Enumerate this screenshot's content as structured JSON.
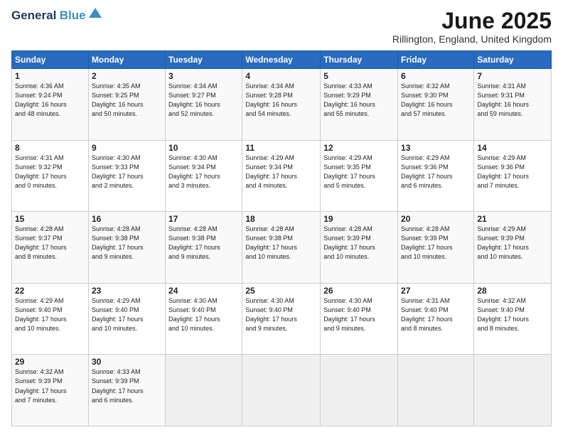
{
  "header": {
    "logo_line1": "General",
    "logo_line2": "Blue",
    "month_title": "June 2025",
    "location": "Rillington, England, United Kingdom"
  },
  "calendar": {
    "days_of_week": [
      "Sunday",
      "Monday",
      "Tuesday",
      "Wednesday",
      "Thursday",
      "Friday",
      "Saturday"
    ],
    "weeks": [
      [
        {
          "day": "1",
          "info": "Sunrise: 4:36 AM\nSunset: 9:24 PM\nDaylight: 16 hours\nand 48 minutes."
        },
        {
          "day": "2",
          "info": "Sunrise: 4:35 AM\nSunset: 9:25 PM\nDaylight: 16 hours\nand 50 minutes."
        },
        {
          "day": "3",
          "info": "Sunrise: 4:34 AM\nSunset: 9:27 PM\nDaylight: 16 hours\nand 52 minutes."
        },
        {
          "day": "4",
          "info": "Sunrise: 4:34 AM\nSunset: 9:28 PM\nDaylight: 16 hours\nand 54 minutes."
        },
        {
          "day": "5",
          "info": "Sunrise: 4:33 AM\nSunset: 9:29 PM\nDaylight: 16 hours\nand 55 minutes."
        },
        {
          "day": "6",
          "info": "Sunrise: 4:32 AM\nSunset: 9:30 PM\nDaylight: 16 hours\nand 57 minutes."
        },
        {
          "day": "7",
          "info": "Sunrise: 4:31 AM\nSunset: 9:31 PM\nDaylight: 16 hours\nand 59 minutes."
        }
      ],
      [
        {
          "day": "8",
          "info": "Sunrise: 4:31 AM\nSunset: 9:32 PM\nDaylight: 17 hours\nand 0 minutes."
        },
        {
          "day": "9",
          "info": "Sunrise: 4:30 AM\nSunset: 9:33 PM\nDaylight: 17 hours\nand 2 minutes."
        },
        {
          "day": "10",
          "info": "Sunrise: 4:30 AM\nSunset: 9:34 PM\nDaylight: 17 hours\nand 3 minutes."
        },
        {
          "day": "11",
          "info": "Sunrise: 4:29 AM\nSunset: 9:34 PM\nDaylight: 17 hours\nand 4 minutes."
        },
        {
          "day": "12",
          "info": "Sunrise: 4:29 AM\nSunset: 9:35 PM\nDaylight: 17 hours\nand 5 minutes."
        },
        {
          "day": "13",
          "info": "Sunrise: 4:29 AM\nSunset: 9:36 PM\nDaylight: 17 hours\nand 6 minutes."
        },
        {
          "day": "14",
          "info": "Sunrise: 4:29 AM\nSunset: 9:36 PM\nDaylight: 17 hours\nand 7 minutes."
        }
      ],
      [
        {
          "day": "15",
          "info": "Sunrise: 4:28 AM\nSunset: 9:37 PM\nDaylight: 17 hours\nand 8 minutes."
        },
        {
          "day": "16",
          "info": "Sunrise: 4:28 AM\nSunset: 9:38 PM\nDaylight: 17 hours\nand 9 minutes."
        },
        {
          "day": "17",
          "info": "Sunrise: 4:28 AM\nSunset: 9:38 PM\nDaylight: 17 hours\nand 9 minutes."
        },
        {
          "day": "18",
          "info": "Sunrise: 4:28 AM\nSunset: 9:38 PM\nDaylight: 17 hours\nand 10 minutes."
        },
        {
          "day": "19",
          "info": "Sunrise: 4:28 AM\nSunset: 9:39 PM\nDaylight: 17 hours\nand 10 minutes."
        },
        {
          "day": "20",
          "info": "Sunrise: 4:28 AM\nSunset: 9:39 PM\nDaylight: 17 hours\nand 10 minutes."
        },
        {
          "day": "21",
          "info": "Sunrise: 4:29 AM\nSunset: 9:39 PM\nDaylight: 17 hours\nand 10 minutes."
        }
      ],
      [
        {
          "day": "22",
          "info": "Sunrise: 4:29 AM\nSunset: 9:40 PM\nDaylight: 17 hours\nand 10 minutes."
        },
        {
          "day": "23",
          "info": "Sunrise: 4:29 AM\nSunset: 9:40 PM\nDaylight: 17 hours\nand 10 minutes."
        },
        {
          "day": "24",
          "info": "Sunrise: 4:30 AM\nSunset: 9:40 PM\nDaylight: 17 hours\nand 10 minutes."
        },
        {
          "day": "25",
          "info": "Sunrise: 4:30 AM\nSunset: 9:40 PM\nDaylight: 17 hours\nand 9 minutes."
        },
        {
          "day": "26",
          "info": "Sunrise: 4:30 AM\nSunset: 9:40 PM\nDaylight: 17 hours\nand 9 minutes."
        },
        {
          "day": "27",
          "info": "Sunrise: 4:31 AM\nSunset: 9:40 PM\nDaylight: 17 hours\nand 8 minutes."
        },
        {
          "day": "28",
          "info": "Sunrise: 4:32 AM\nSunset: 9:40 PM\nDaylight: 17 hours\nand 8 minutes."
        }
      ],
      [
        {
          "day": "29",
          "info": "Sunrise: 4:32 AM\nSunset: 9:39 PM\nDaylight: 17 hours\nand 7 minutes."
        },
        {
          "day": "30",
          "info": "Sunrise: 4:33 AM\nSunset: 9:39 PM\nDaylight: 17 hours\nand 6 minutes."
        },
        {
          "day": "",
          "info": ""
        },
        {
          "day": "",
          "info": ""
        },
        {
          "day": "",
          "info": ""
        },
        {
          "day": "",
          "info": ""
        },
        {
          "day": "",
          "info": ""
        }
      ]
    ]
  }
}
